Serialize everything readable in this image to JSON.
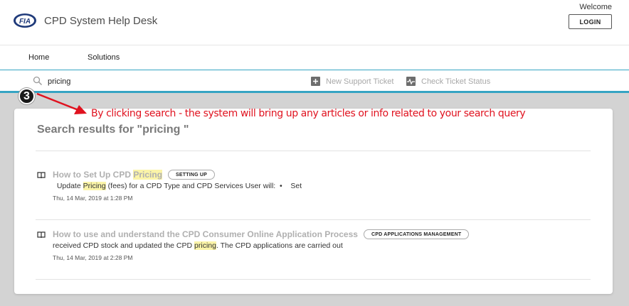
{
  "header": {
    "title": "CPD System Help Desk",
    "logo_text": "FIA",
    "welcome": "Welcome",
    "login_label": "LOGIN"
  },
  "nav": {
    "items": [
      {
        "label": "Home"
      },
      {
        "label": "Solutions"
      }
    ]
  },
  "search": {
    "value": "pricing",
    "new_ticket_label": "New Support Ticket",
    "check_status_label": "Check Ticket Status"
  },
  "annotation": {
    "step": "3",
    "text": "By clicking search - the system will bring up any articles or info related to your search query",
    "color": "#e0121f"
  },
  "results": {
    "heading": "Search results for \"pricing \"",
    "items": [
      {
        "title_before": "How to Set Up CPD ",
        "title_highlight": "Pricing",
        "title_after": "",
        "tag": "SETTING UP",
        "snippet_before": "  Update ",
        "snippet_highlight": "Pricing",
        "snippet_after": " (fees) for a CPD Type and CPD Services User will:  •    Set",
        "date": "Thu, 14 Mar, 2019 at 1:28 PM"
      },
      {
        "title_before": "How to use and understand the CPD Consumer Online Application Process",
        "title_highlight": "",
        "title_after": "",
        "tag": "CPD APPLICATIONS MANAGEMENT",
        "snippet_before": "received CPD stock and updated the CPD ",
        "snippet_highlight": "pricing",
        "snippet_after": ". The CPD applications are carried out",
        "date": "Thu, 14 Mar, 2019 at 2:28 PM"
      }
    ]
  },
  "colors": {
    "accent": "#35a4c3",
    "highlight": "#fbf4a8",
    "background": "#d3d3d3"
  }
}
